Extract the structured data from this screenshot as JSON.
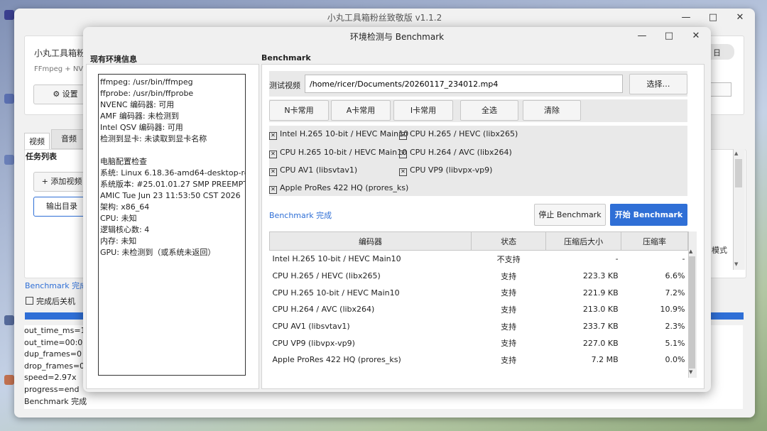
{
  "main_window": {
    "title": "小丸工具箱粉丝致敬版 v1.1.2",
    "app_name_partial": "小丸工具箱粉丝",
    "subtitle_partial": "FFmpeg + NVI",
    "settings_button": "⚙ 设置",
    "tabs": [
      "视频",
      "音频"
    ],
    "task_list_label": "任务列表",
    "add_video_button": "+ 添加视频",
    "output_dir_button": "输出目录",
    "right_partial_label": "日",
    "mode_partial_label": "模式",
    "benchmark_status": "Benchmark 完成",
    "shutdown_after_label": "完成后关机",
    "log_lines": [
      "out_time_ms=11",
      "out_time=00:00:1",
      "dup_frames=0",
      "drop_frames=0",
      "speed=2.97x",
      "progress=end",
      "Benchmark 完成"
    ],
    "progress_fraction": 1.0
  },
  "dialog": {
    "title": "环境检测与 Benchmark",
    "env_section_title": "现有环境信息",
    "env_text": "ffmpeg: /usr/bin/ffmpeg\nffprobe: /usr/bin/ffprobe\nNVENC 编码器: 可用\nAMF 编码器: 未检测到\nIntel QSV 编码器: 可用\n检测到显卡: 未读取到显卡名称\n\n电脑配置检查\n系统: Linux 6.18.36-amd64-desktop-rolling\n系统版本: #25.01.01.27 SMP PREEMPT_DYN\nAMIC Tue Jun 23 11:53:50 CST 2026\n架构: x86_64\nCPU: 未知\n逻辑核心数: 4\n内存: 未知\nGPU: 未检测到（或系统未返回）",
    "bench_section_title": "Benchmark",
    "test_video_label": "测试视频",
    "test_video_path": "/home/ricer/Documents/20260117_234012.mp4",
    "choose_button": "选择…",
    "preset_buttons": [
      "N卡常用",
      "A卡常用",
      "I卡常用",
      "全选",
      "清除"
    ],
    "encoders_checked": [
      "Intel H.265 10-bit / HEVC Main10",
      "CPU H.265 / HEVC (libx265)",
      "CPU H.265 10-bit / HEVC Main10",
      "CPU H.264 / AVC (libx264)",
      "CPU AV1 (libsvtav1)",
      "CPU VP9 (libvpx-vp9)",
      "Apple ProRes 422 HQ (prores_ks)"
    ],
    "bench_status": "Benchmark 完成",
    "stop_button": "停止 Benchmark",
    "start_button": "开始 Benchmark",
    "table_headers": [
      "编码器",
      "状态",
      "压缩后大小",
      "压缩率"
    ],
    "rows": [
      {
        "encoder": "Intel H.265 10-bit / HEVC Main10",
        "status": "不支持",
        "size": "-",
        "ratio": "-"
      },
      {
        "encoder": "CPU H.265 / HEVC (libx265)",
        "status": "支持",
        "size": "223.3 KB",
        "ratio": "6.6%"
      },
      {
        "encoder": "CPU H.265 10-bit / HEVC Main10",
        "status": "支持",
        "size": "221.9 KB",
        "ratio": "7.2%"
      },
      {
        "encoder": "CPU H.264 / AVC (libx264)",
        "status": "支持",
        "size": "213.0 KB",
        "ratio": "10.9%"
      },
      {
        "encoder": "CPU AV1 (libsvtav1)",
        "status": "支持",
        "size": "233.7 KB",
        "ratio": "2.3%"
      },
      {
        "encoder": "CPU VP9 (libvpx-vp9)",
        "status": "支持",
        "size": "227.0 KB",
        "ratio": "5.1%"
      },
      {
        "encoder": "Apple ProRes 422 HQ (prores_ks)",
        "status": "支持",
        "size": "7.2 MB",
        "ratio": "0.0%"
      }
    ],
    "colors": {
      "accent": "#2f6fd6",
      "link": "#2f6fd6"
    }
  }
}
